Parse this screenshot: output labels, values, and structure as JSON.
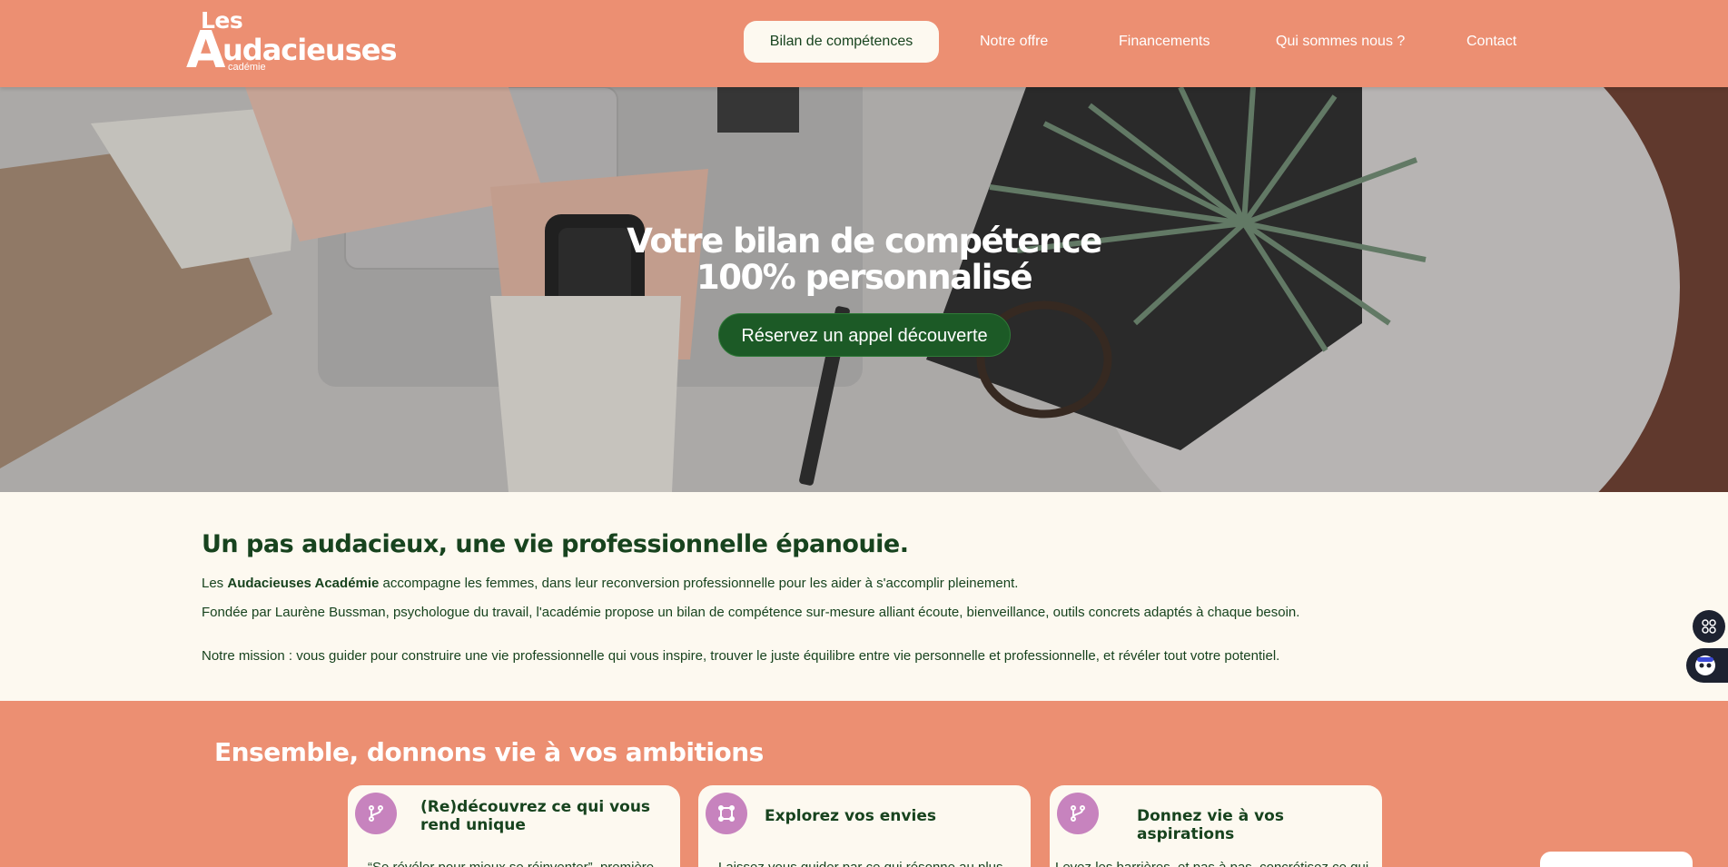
{
  "header": {
    "logo": {
      "line1": "Les",
      "big_letter": "A",
      "rest": "udacieuses",
      "sub": "cadémie"
    },
    "nav": [
      {
        "label": "Bilan de compétences",
        "active": true
      },
      {
        "label": "Notre offre",
        "active": false
      },
      {
        "label": "Financements",
        "active": false
      },
      {
        "label": "Qui sommes nous ?",
        "active": false
      },
      {
        "label": "Contact",
        "active": false
      }
    ]
  },
  "hero": {
    "title_line1": "Votre bilan de compétence",
    "title_line2": "100% personnalisé",
    "cta_label": "Réservez un appel découverte"
  },
  "intro": {
    "title": "Un pas audacieux, une vie professionnelle épanouie.",
    "p1_start": "Les ",
    "p1_bold": "Audacieuses Académie",
    "p1_end": " accompagne les femmes, dans leur reconversion professionnelle pour les aider à s'accomplir pleinement.",
    "p2": "Fondée par Laurène Bussman, psychologue du travail, l'académie propose un bilan de compétence sur-mesure alliant écoute, bienveillance, outils concrets adaptés à chaque besoin.",
    "p3": "Notre mission : vous guider pour construire une vie professionnelle qui vous inspire, trouver le juste équilibre entre vie personnelle et professionnelle, et révéler tout votre potentiel."
  },
  "ambitions": {
    "title": "Ensemble, donnons vie à vos ambitions",
    "cards": [
      {
        "icon": "branch-icon",
        "title": "(Re)découvrez ce qui  vous rend unique",
        "text": "“Se révéler pour mieux se réinventer”, première"
      },
      {
        "icon": "frame-icon",
        "title": "Explorez vos envies",
        "text": "Laissez vous guider par ce qui résonne au plus"
      },
      {
        "icon": "branch-icon",
        "title": "Donnez vie à vos aspirations",
        "text": "Levez les barrières, et pas à pas, concrétisez ce qui"
      }
    ]
  },
  "colors": {
    "brand": "#ec8f72",
    "dark_green": "#17431e",
    "cta_green": "#1c5a26",
    "cream": "#fdf9f0",
    "icon_purple": "#c783be"
  }
}
